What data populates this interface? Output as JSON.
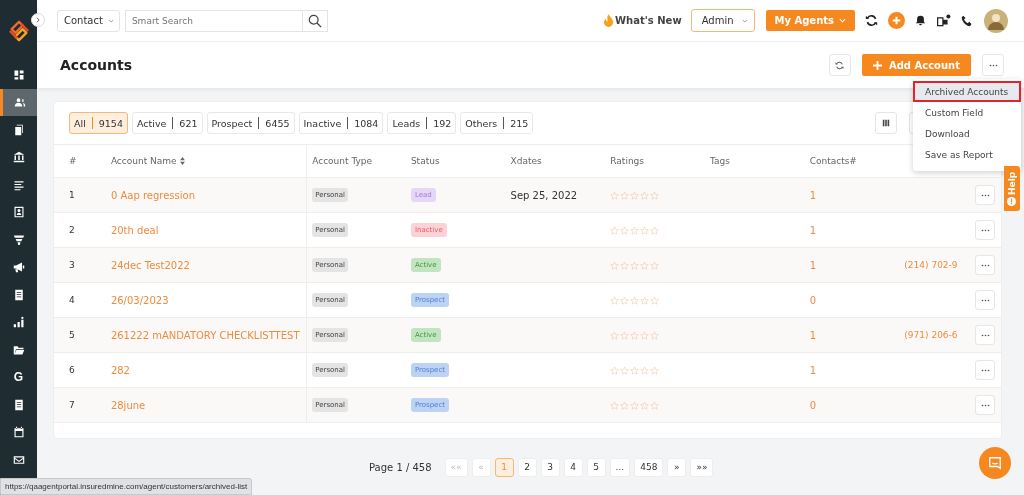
{
  "sidebar": {
    "items": [
      {
        "selected": false
      },
      {
        "selected": true
      },
      {
        "selected": false
      },
      {
        "selected": false
      },
      {
        "selected": false
      },
      {
        "selected": false
      },
      {
        "selected": false
      },
      {
        "selected": false
      },
      {
        "selected": false
      },
      {
        "selected": false
      },
      {
        "selected": false
      },
      {
        "text": "G",
        "selected": false
      },
      {
        "selected": false
      },
      {
        "selected": false
      },
      {
        "selected": false
      }
    ]
  },
  "topbar": {
    "module_select": "Contact",
    "search": {
      "placeholder": "Smart Search"
    },
    "whats_new": "What's New",
    "role_select": "Admin",
    "agents_button": "My Agents",
    "notification_dot": true
  },
  "page_header": {
    "title": "Accounts",
    "add_button": "Add Account"
  },
  "menu": {
    "items": [
      {
        "label": "Archived Accounts",
        "selected": true
      },
      {
        "label": "Custom Field",
        "selected": false
      },
      {
        "label": "Download",
        "selected": false
      },
      {
        "label": "Save as Report",
        "selected": false
      }
    ]
  },
  "filters": [
    {
      "label": "All",
      "count": "9154",
      "selected": true
    },
    {
      "label": "Active",
      "count": "621",
      "selected": false
    },
    {
      "label": "Prospect",
      "count": "6455",
      "selected": false
    },
    {
      "label": "Inactive",
      "count": "1084",
      "selected": false
    },
    {
      "label": "Leads",
      "count": "192",
      "selected": false
    },
    {
      "label": "Others",
      "count": "215",
      "selected": false
    }
  ],
  "table": {
    "columns": [
      "#",
      "Account Name",
      "Account Type",
      "Status",
      "Xdates",
      "Ratings",
      "Tags",
      "Contacts#"
    ],
    "rows": [
      {
        "num": "1",
        "name": "0 Aap regression",
        "type": "Personal",
        "status": {
          "label": "Lead",
          "kind": "lead"
        },
        "xdate": "Sep 25, 2022",
        "stars": 0,
        "contacts": "1"
      },
      {
        "num": "2",
        "name": "20th deal",
        "type": "Personal",
        "status": {
          "label": "Inactive",
          "kind": "inactive"
        },
        "stars": 0,
        "contacts": "1"
      },
      {
        "num": "3",
        "name": "24dec Test2022",
        "type": "Personal",
        "status": {
          "label": "Active",
          "kind": "active"
        },
        "stars": 0,
        "contacts": "1",
        "phone": "(214) 702-9"
      },
      {
        "num": "4",
        "name": "26/03/2023",
        "type": "Personal",
        "status": {
          "label": "Prospect",
          "kind": "prospect"
        },
        "stars": 0,
        "contacts": "0"
      },
      {
        "num": "5",
        "name": "261222 mANDATORY CHECKLISTTEST",
        "type": "Personal",
        "status": {
          "label": "Active",
          "kind": "active"
        },
        "stars": 0,
        "contacts": "1",
        "phone": "(971) 206-6"
      },
      {
        "num": "6",
        "name": "282",
        "type": "Personal",
        "status": {
          "label": "Prospect",
          "kind": "prospect"
        },
        "stars": 0,
        "contacts": "1"
      },
      {
        "num": "7",
        "name": "28june",
        "type": "Personal",
        "status": {
          "label": "Prospect",
          "kind": "prospect"
        },
        "stars": 0,
        "contacts": "0"
      }
    ]
  },
  "pagination": {
    "summary": "Page 1 / 458",
    "first": "««",
    "prev": "«",
    "pages": [
      {
        "label": "1",
        "selected": true
      },
      {
        "label": "2",
        "selected": false
      },
      {
        "label": "3",
        "selected": false
      },
      {
        "label": "4",
        "selected": false
      },
      {
        "label": "5",
        "selected": false
      },
      {
        "label": "...",
        "selected": false
      },
      {
        "label": "458",
        "selected": false
      }
    ],
    "next": "»",
    "last": "»»"
  },
  "help_tab": "Help",
  "status_url": "https://qaagentportal.insuredmine.com/agent/customers/archived-list"
}
